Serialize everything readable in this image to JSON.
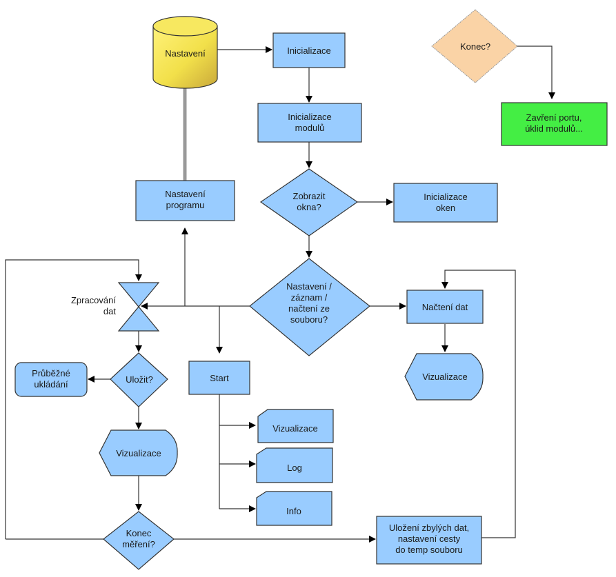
{
  "colors": {
    "process_fill": "#99ccff",
    "storage_fill": "#f2e04a",
    "decision_end_fill": "#fad3a6",
    "terminal_fill": "#44ee44",
    "stroke": "#333333"
  },
  "nodes": {
    "settings_store": [
      "Nastavení"
    ],
    "init": [
      "Inicializace"
    ],
    "init_modules": [
      "Inicializace",
      "modulů"
    ],
    "show_windows": [
      "Zobrazit",
      "okna?"
    ],
    "init_windows": [
      "Inicializace",
      "oken"
    ],
    "program_settings": [
      "Nastavení",
      "programu"
    ],
    "mode_decision": [
      "Nastavení /",
      "záznam /",
      "načtení ze",
      "souboru?"
    ],
    "load_data": [
      "Načtení dat"
    ],
    "visualize_right": [
      "Vizualizace"
    ],
    "process_data": [
      "Zpracování",
      "dat"
    ],
    "save_decision": [
      "Uložit?"
    ],
    "continuous_save": [
      "Průběžné",
      "ukládání"
    ],
    "visualize_left": [
      "Vizualizace"
    ],
    "start": [
      "Start"
    ],
    "out_visualize": [
      "Vizualizace"
    ],
    "out_log": [
      "Log"
    ],
    "out_info": [
      "Info"
    ],
    "end_measure": [
      "Konec",
      "měření?"
    ],
    "save_remaining": [
      "Uložení zbylých dat,",
      "nastavení cesty",
      "do temp souboru"
    ],
    "end_decision": [
      "Konec?"
    ],
    "close_port": [
      "Zavření portu,",
      "úklid modulů..."
    ]
  }
}
